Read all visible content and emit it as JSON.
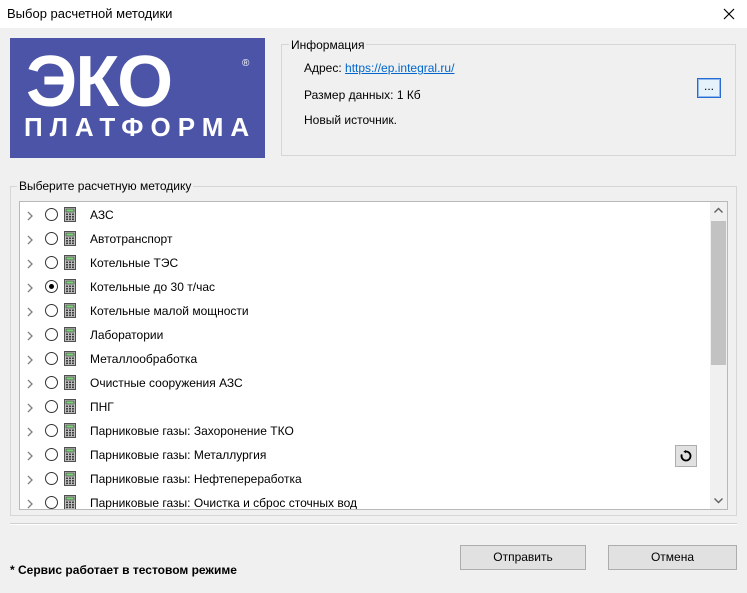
{
  "window": {
    "title": "Выбор расчетной методики"
  },
  "logo": {
    "main": "ЭКО",
    "sub": "ПЛАТФОРМА",
    "reg": "®"
  },
  "info": {
    "legend": "Информация",
    "address_label": "Адрес:",
    "address_url": "https://ep.integral.ru/",
    "size_label": "Размер данных:",
    "size_value": "1 Кб",
    "source_text": "Новый источник.",
    "browse_label": "..."
  },
  "methods": {
    "legend": "Выберите расчетную методику",
    "items": [
      {
        "label": "АЗС",
        "selected": false
      },
      {
        "label": "Автотранспорт",
        "selected": false
      },
      {
        "label": "Котельные ТЭС",
        "selected": false
      },
      {
        "label": "Котельные до 30 т/час",
        "selected": true
      },
      {
        "label": "Котельные малой мощности",
        "selected": false
      },
      {
        "label": "Лаборатории",
        "selected": false
      },
      {
        "label": "Металлообработка",
        "selected": false
      },
      {
        "label": "Очистные сооружения АЗС",
        "selected": false
      },
      {
        "label": "ПНГ",
        "selected": false
      },
      {
        "label": "Парниковые газы: Захоронение ТКО",
        "selected": false
      },
      {
        "label": "Парниковые газы: Металлургия",
        "selected": false
      },
      {
        "label": "Парниковые газы: Нефтепереработка",
        "selected": false
      },
      {
        "label": "Парниковые газы: Очистка и сброс сточных вод",
        "selected": false
      }
    ]
  },
  "footer": {
    "note": "* Сервис работает в тестовом режиме",
    "submit_label": "Отправить",
    "cancel_label": "Отмена"
  },
  "colors": {
    "logo_bg": "#4b54a6",
    "link": "#0066cc",
    "focus": "#2a6bd1"
  }
}
